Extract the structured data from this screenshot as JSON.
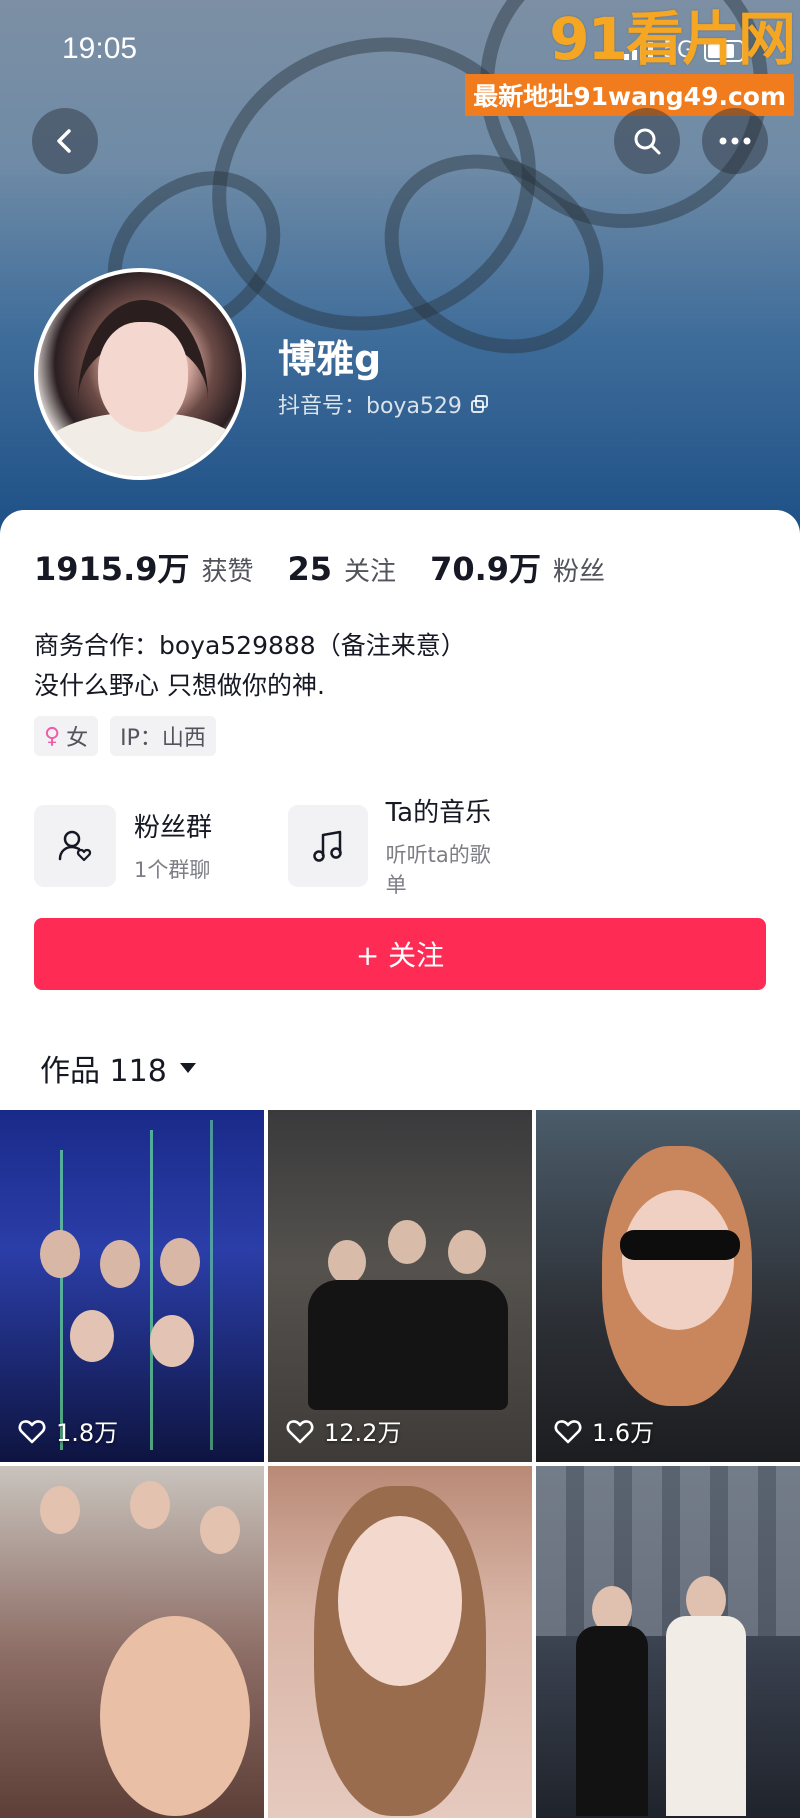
{
  "status_bar": {
    "time": "19:05",
    "network": "5G"
  },
  "watermark": {
    "logo": "91看片网",
    "url": "最新地址91wang49.com"
  },
  "profile": {
    "nickname": "博雅g",
    "douyin_id": "抖音号：boya529"
  },
  "stats": [
    {
      "value": "1915.9万",
      "label": "获赞"
    },
    {
      "value": "25",
      "label": "关注"
    },
    {
      "value": "70.9万",
      "label": "粉丝"
    }
  ],
  "bio": {
    "line1": "商务合作：boya529888（备注来意）",
    "line2": "没什么野心 只想做你的神."
  },
  "tags": {
    "gender": "女",
    "ip": "IP：山西"
  },
  "entries": [
    {
      "title": "粉丝群",
      "subtitle": "1个群聊",
      "icon": "fan-group-icon"
    },
    {
      "title": "Ta的音乐",
      "subtitle": "听听ta的歌单",
      "icon": "music-note-icon"
    }
  ],
  "follow_button": {
    "label": "+ 关注",
    "color": "#fe2c55"
  },
  "works_tab": {
    "label": "作品 118"
  },
  "videos": [
    {
      "likes": "1.8万"
    },
    {
      "likes": "12.2万"
    },
    {
      "likes": "1.6万"
    },
    {
      "likes": ""
    },
    {
      "likes": ""
    },
    {
      "likes": ""
    }
  ]
}
